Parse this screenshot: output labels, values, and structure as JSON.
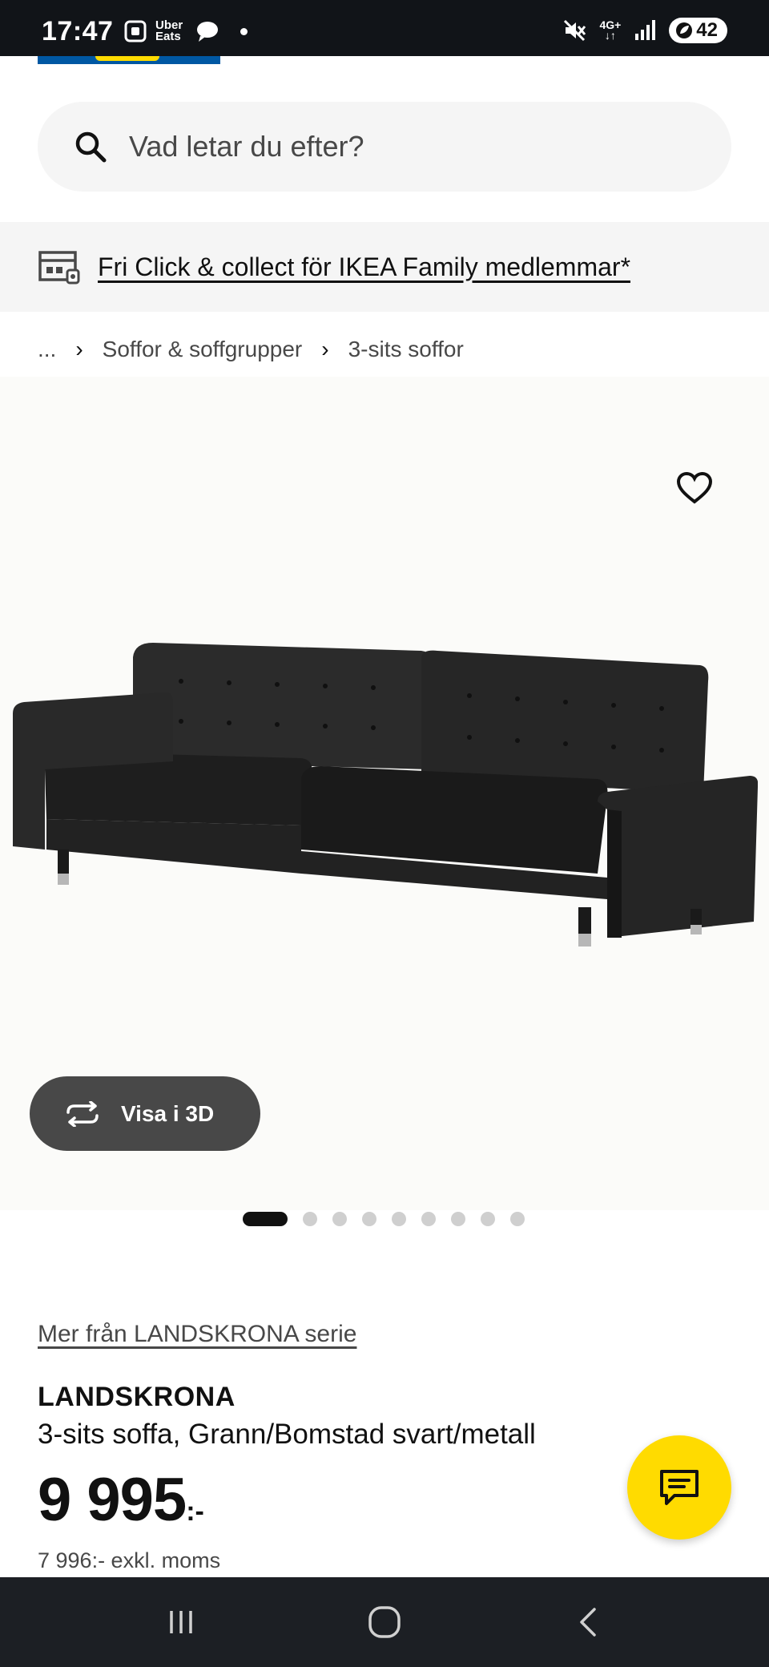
{
  "status_bar": {
    "time": "17:47",
    "app_label": "Uber\nEats",
    "network": "4G+",
    "battery": "42"
  },
  "search": {
    "placeholder": "Vad letar du efter?"
  },
  "promo": {
    "text": "Fri Click & collect för IKEA Family medlemmar*"
  },
  "breadcrumb": {
    "ellipsis": "...",
    "items": [
      "Soffor & soffgrupper",
      "3-sits soffor"
    ]
  },
  "gallery": {
    "view_3d_label": "Visa i 3D",
    "image_count": 9,
    "active_index": 0
  },
  "product": {
    "series_link": "Mer från LANDSKRONA serie",
    "name": "LANDSKRONA",
    "description": "3-sits soffa, Grann/Bomstad svart/metall",
    "price": "9 995",
    "price_suffix": ":-",
    "price_excl_vat": "7 996:- exkl. moms"
  },
  "colors": {
    "ikea_blue": "#0058a3",
    "ikea_yellow": "#ffdb00",
    "button_dark": "#484848"
  }
}
